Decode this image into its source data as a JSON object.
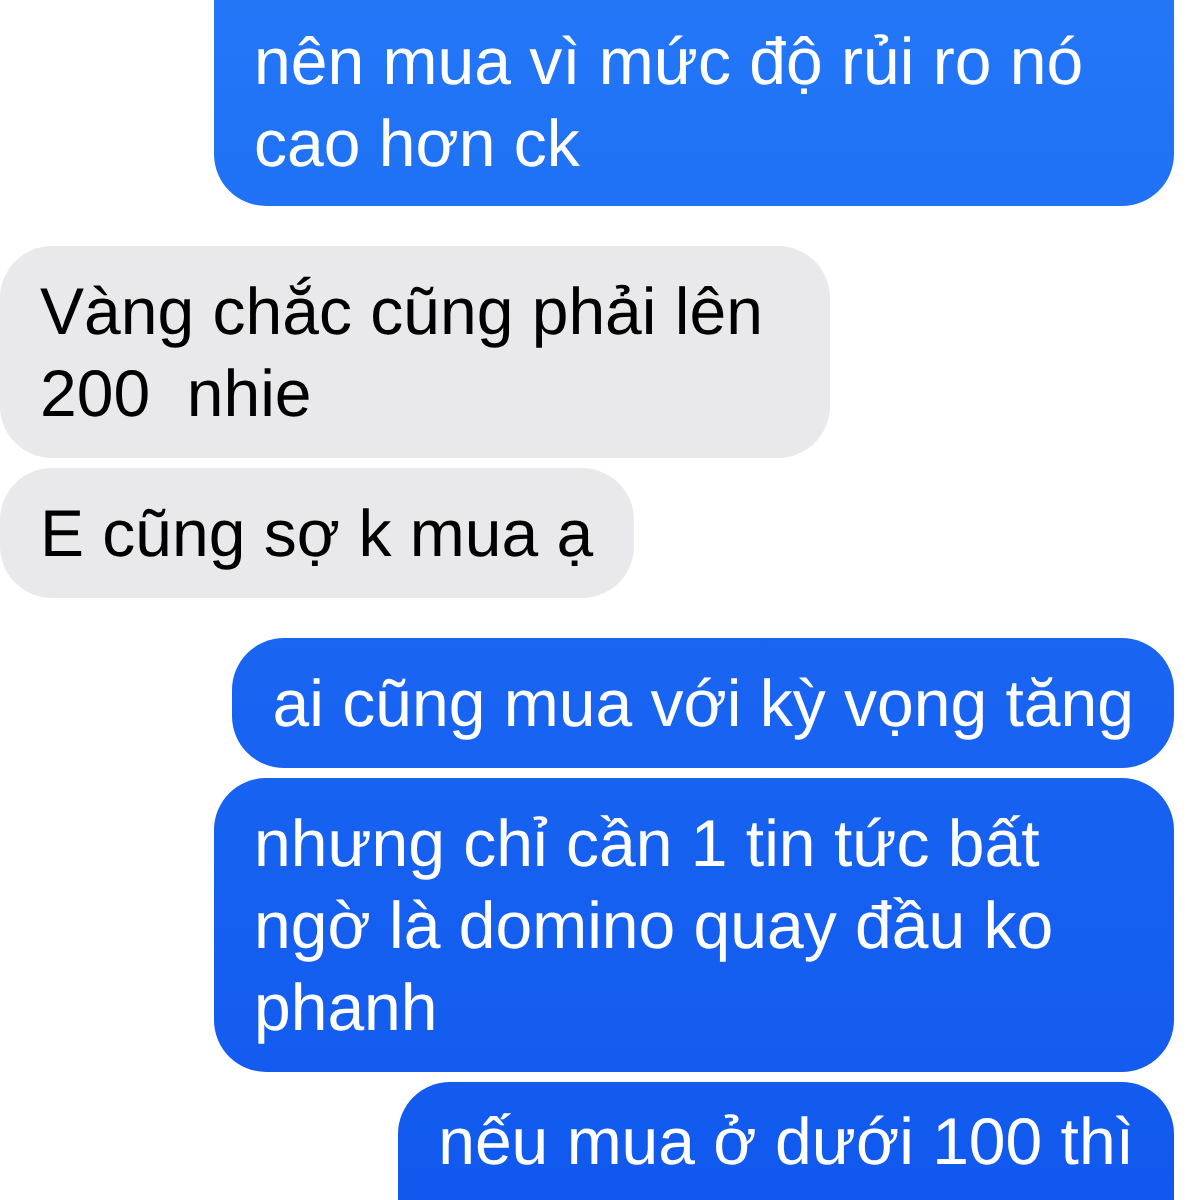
{
  "messages": [
    {
      "kind": "sent",
      "text": "nên mua vì mức độ rủi ro nó cao hơn ck"
    },
    {
      "kind": "received",
      "text": "Vàng chắc cũng phải lên 200  nhie"
    },
    {
      "kind": "received",
      "text": "E cũng sợ k mua ạ"
    },
    {
      "kind": "sent",
      "text": "ai cũng mua với kỳ vọng tăng"
    },
    {
      "kind": "sent",
      "text": "nhưng chỉ cần 1 tin tức bất ngờ là domino quay đầu ko phanh"
    },
    {
      "kind": "sent",
      "text": "nếu mua ở dưới 100 thì"
    }
  ]
}
